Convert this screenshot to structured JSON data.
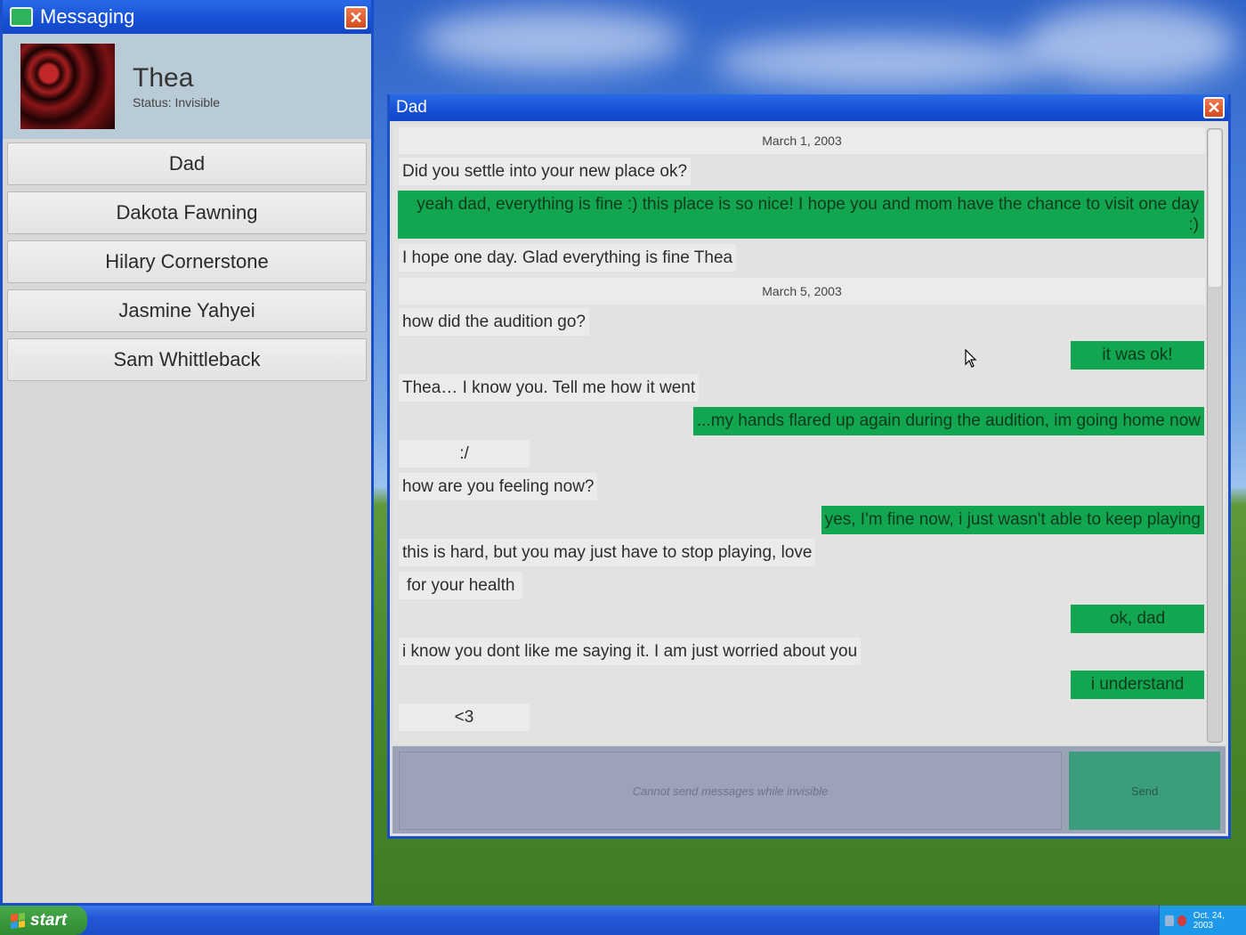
{
  "messaging_window": {
    "title": "Messaging",
    "profile": {
      "name": "Thea",
      "status": "Status: Invisible"
    },
    "contacts": [
      "Dad",
      "Dakota Fawning",
      "Hilary Cornerstone",
      "Jasmine Yahyei",
      "Sam Whittleback"
    ]
  },
  "chat_window": {
    "title": "Dad",
    "dates": [
      "March 1, 2003",
      "March 5, 2003"
    ],
    "messages": [
      {
        "dir": "in",
        "text": "Did you settle into your new place ok?"
      },
      {
        "dir": "out",
        "text": "yeah dad, everything is fine :) this place is so nice! I hope you and mom have the chance to visit one day :)"
      },
      {
        "dir": "in",
        "text": "I hope one day. Glad everything is fine Thea"
      },
      {
        "dir": "in",
        "text": "how did the audition go?"
      },
      {
        "dir": "out",
        "text": "it was ok!"
      },
      {
        "dir": "in",
        "text": "Thea… I know you. Tell me how it went"
      },
      {
        "dir": "out",
        "text": "...my hands flared up again during the audition, im going home now"
      },
      {
        "dir": "in",
        "text": ":/"
      },
      {
        "dir": "in",
        "text": "how are you feeling now?"
      },
      {
        "dir": "out",
        "text": "yes, I'm fine now, i just wasn't able to keep playing"
      },
      {
        "dir": "in",
        "text": "this is hard, but you may just have to stop playing, love"
      },
      {
        "dir": "in",
        "text": "for your health"
      },
      {
        "dir": "out",
        "text": "ok, dad"
      },
      {
        "dir": "in",
        "text": "i know you dont like me saying it. I am just worried about you"
      },
      {
        "dir": "out",
        "text": "i understand"
      },
      {
        "dir": "in",
        "text": "<3"
      }
    ],
    "compose": {
      "placeholder": "Cannot send messages while invisible",
      "send_label": "Send"
    }
  },
  "taskbar": {
    "start_label": "start",
    "date": "Oct. 24, 2003"
  },
  "colors": {
    "titlebar": "#1650d6",
    "outgoing_bubble": "#12a651",
    "incoming_bubble": "#ebebeb",
    "send_button": "#3b9d7c"
  },
  "icons": [
    "messaging-app-icon",
    "close-icon",
    "windows-logo-icon",
    "tray-icon",
    "mouse-cursor-icon"
  ]
}
